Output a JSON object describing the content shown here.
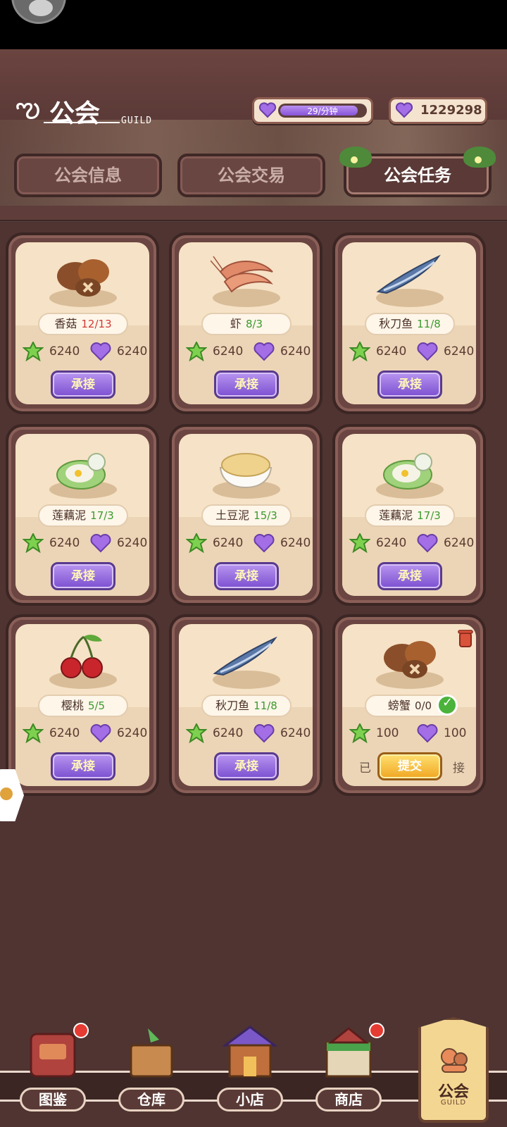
{
  "header": {
    "guild_title": "公会",
    "guild_sub": "GUILD",
    "energy_rate": "29/分钟",
    "energy_level": 0.92,
    "gem_count": "1229298"
  },
  "tabs": [
    {
      "label": "公会信息",
      "active": false
    },
    {
      "label": "公会交易",
      "active": false
    },
    {
      "label": "公会任务",
      "active": true
    }
  ],
  "tasks": [
    {
      "name": "香菇",
      "count": "12/13",
      "count_color": "red",
      "star": "6240",
      "heart": "6240",
      "action": "承接",
      "icon": "mushroom-icon"
    },
    {
      "name": "虾",
      "count": "8/3",
      "count_color": "green",
      "star": "6240",
      "heart": "6240",
      "action": "承接",
      "icon": "shrimp-icon"
    },
    {
      "name": "秋刀鱼",
      "count": "11/8",
      "count_color": "green",
      "star": "6240",
      "heart": "6240",
      "action": "承接",
      "icon": "saury-fish-icon"
    },
    {
      "name": "莲藕泥",
      "count": "17/3",
      "count_color": "green",
      "star": "6240",
      "heart": "6240",
      "action": "承接",
      "icon": "lotus-puree-icon"
    },
    {
      "name": "土豆泥",
      "count": "15/3",
      "count_color": "green",
      "star": "6240",
      "heart": "6240",
      "action": "承接",
      "icon": "mashed-potato-icon"
    },
    {
      "name": "莲藕泥",
      "count": "17/3",
      "count_color": "green",
      "star": "6240",
      "heart": "6240",
      "action": "承接",
      "icon": "lotus-puree-icon"
    },
    {
      "name": "樱桃",
      "count": "5/5",
      "count_color": "green",
      "star": "6240",
      "heart": "6240",
      "action": "承接",
      "icon": "cherry-icon"
    },
    {
      "name": "秋刀鱼",
      "count": "11/8",
      "count_color": "green",
      "star": "6240",
      "heart": "6240",
      "action": "承接",
      "icon": "saury-fish-icon"
    },
    {
      "name": "螃蟹",
      "count": "0/0",
      "count_color": "plain",
      "star": "100",
      "heart": "100",
      "action": "提交",
      "accepted_left": "已",
      "accepted_right": "接",
      "icon": "mushroom-icon"
    }
  ],
  "nav": [
    {
      "label": "图鉴",
      "badge": true,
      "icon": "book-icon"
    },
    {
      "label": "仓库",
      "badge": false,
      "icon": "warehouse-icon"
    },
    {
      "label": "小店",
      "badge": false,
      "icon": "shop-icon"
    },
    {
      "label": "商店",
      "badge": true,
      "icon": "store-icon"
    }
  ],
  "nav_active": {
    "label": "公会",
    "sub": "GUILD",
    "icon": "guild-icon"
  },
  "colors": {
    "accent_purple": "#8654d8",
    "badge_red": "#e53b33",
    "count_red": "#d23a34",
    "count_green": "#3a9a2e"
  }
}
